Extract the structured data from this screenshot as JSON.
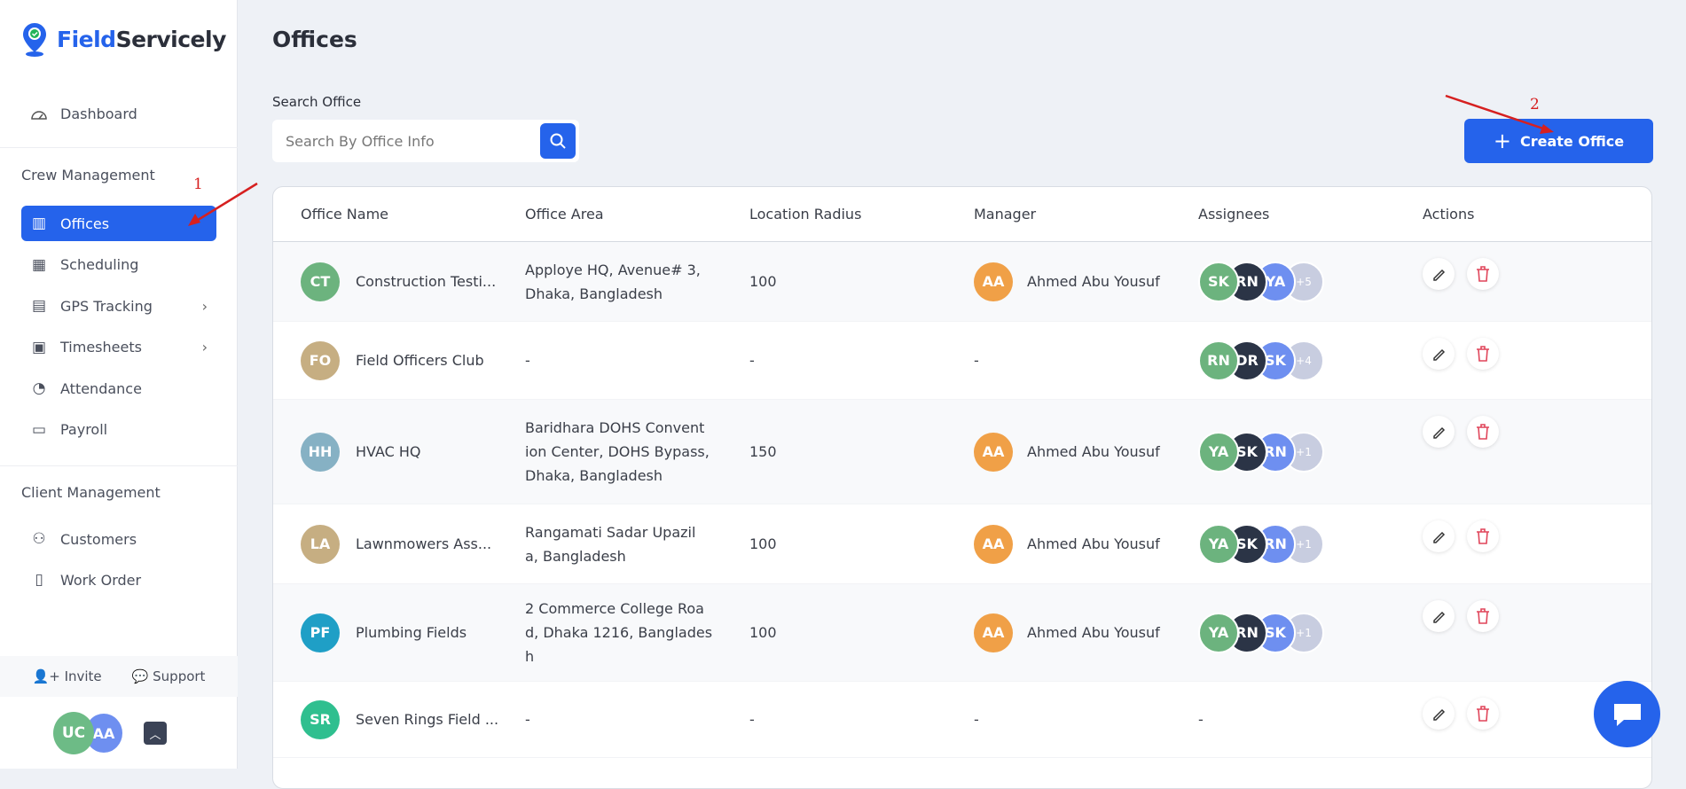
{
  "app": {
    "brand_part1": "Field",
    "brand_part2": "Servicely",
    "accent": "#2563eb"
  },
  "sidebar": {
    "dashboard": "Dashboard",
    "crew_section": "Crew Management",
    "crew_items": [
      {
        "label": "Offices",
        "icon": "building-icon",
        "active": true
      },
      {
        "label": "Scheduling",
        "icon": "calendar-icon"
      },
      {
        "label": "GPS Tracking",
        "icon": "document-icon",
        "chevron": true
      },
      {
        "label": "Timesheets",
        "icon": "timesheet-icon",
        "chevron": true
      },
      {
        "label": "Attendance",
        "icon": "gauge-icon"
      },
      {
        "label": "Payroll",
        "icon": "wallet-icon"
      }
    ],
    "client_section": "Client Management",
    "client_items": [
      {
        "label": "Customers",
        "icon": "users-icon"
      },
      {
        "label": "Work Order",
        "icon": "work-order-icon"
      }
    ],
    "invite": "Invite",
    "support": "Support",
    "user_avatars": [
      {
        "initials": "UC",
        "color": "#6dbb86"
      },
      {
        "initials": "AA",
        "color": "#6e8ff0"
      }
    ]
  },
  "page": {
    "title": "Offices",
    "search_label": "Search Office",
    "search_placeholder": "Search By Office Info",
    "search_value": "",
    "create_label": "Create Office"
  },
  "table": {
    "headers": [
      "Office Name",
      "Office Area",
      "Location Radius",
      "Manager",
      "Assignees",
      "Actions"
    ],
    "rows": [
      {
        "initials": "CT",
        "color": "#6cb37e",
        "name": "Construction Testi...",
        "area": [
          "Apploye HQ, Avenue# 3,",
          "Dhaka, Bangladesh"
        ],
        "radius": "100",
        "manager": "Ahmed Abu Yousuf",
        "manager_initials": "AA",
        "assignees": [
          "SK",
          "RN",
          "YA"
        ],
        "more": "+5",
        "h": 90
      },
      {
        "initials": "FO",
        "color": "#c6ae82",
        "name": "Field Officers Club",
        "area": [
          "-"
        ],
        "radius": "-",
        "manager": "-",
        "manager_initials": "",
        "assignees": [
          "RN",
          "DR",
          "SK"
        ],
        "more": "+4",
        "h": 88
      },
      {
        "initials": "HH",
        "color": "#86b1c4",
        "name": "HVAC HQ",
        "area": [
          "Baridhara DOHS Convent",
          "ion Center, DOHS Bypass,",
          "Dhaka, Bangladesh"
        ],
        "radius": "150",
        "manager": "Ahmed Abu Yousuf",
        "manager_initials": "AA",
        "assignees": [
          "YA",
          "SK",
          "RN"
        ],
        "more": "+1",
        "h": 118
      },
      {
        "initials": "LA",
        "color": "#c6ae82",
        "name": "Lawnmowers Ass...",
        "area": [
          "Rangamati Sadar Upazil",
          "a, Bangladesh"
        ],
        "radius": "100",
        "manager": "Ahmed Abu Yousuf",
        "manager_initials": "AA",
        "assignees": [
          "YA",
          "SK",
          "RN"
        ],
        "more": "+1",
        "h": 90
      },
      {
        "initials": "PF",
        "color": "#1f9fc6",
        "name": "Plumbing Fields",
        "area": [
          "2 Commerce College Roa",
          "d, Dhaka 1216, Banglades",
          "h"
        ],
        "radius": "100",
        "manager": "Ahmed Abu Yousuf",
        "manager_initials": "AA",
        "assignees": [
          "YA",
          "RN",
          "SK"
        ],
        "more": "+1",
        "h": 110
      },
      {
        "initials": "SR",
        "color": "#2fbf8f",
        "name": "Seven Rings Field ...",
        "area": [
          "-"
        ],
        "radius": "-",
        "manager": "-",
        "manager_initials": "",
        "assignees": [],
        "more": "",
        "h": 86
      }
    ]
  },
  "annotations": {
    "one": "1",
    "two": "2",
    "color": "#d62020"
  }
}
